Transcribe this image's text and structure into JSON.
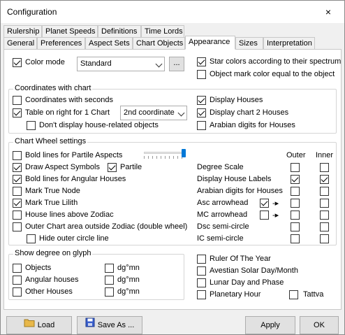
{
  "window": {
    "title": "Configuration",
    "close": "×"
  },
  "tabs_row1": [
    "Rulership",
    "Planet Speeds",
    "Definitions",
    "Time Lords"
  ],
  "tabs_row2": [
    "General",
    "Preferences",
    "Aspect Sets",
    "Chart Objects",
    "Appearance",
    "Sizes",
    "Interpretation"
  ],
  "top": {
    "color_mode": "Color mode",
    "color_mode_value": "Standard",
    "ellipsis": "...",
    "star_colors": "Star colors according to their spectrum",
    "object_mark": "Object mark color equal to the object"
  },
  "coords": {
    "legend": "Coordinates with chart",
    "with_seconds": "Coordinates with seconds",
    "table_right": "Table on right for 1 Chart",
    "coord_value": "2nd coordinate",
    "no_house": "Don't display house-related objects",
    "display_houses": "Display Houses",
    "display_chart2": "Display chart 2 Houses",
    "arabian_houses": "Arabian digits for Houses"
  },
  "wheel": {
    "legend": "Chart Wheel settings",
    "bold_partile": "Bold lines for Partile Aspects",
    "draw_aspect": "Draw Aspect Symbols",
    "partile": "Partile",
    "bold_angular": "Bold lines for Angular Houses",
    "mark_node": "Mark True Node",
    "mark_lilith": "Mark True Lilith",
    "house_above": "House lines above Zodiac",
    "outer_area": "Outer Chart area outside Zodiac (double wheel)",
    "hide_outer": "Hide outer circle line",
    "outer": "Outer",
    "inner": "Inner",
    "right_rows": [
      "Degree Scale",
      "Display House Labels",
      "Arabian digits for Houses",
      "Asc arrowhead",
      "MC arrowhead",
      "Dsc semi-circle",
      "IC semi-circle"
    ],
    "arrow": "-▸"
  },
  "glyph": {
    "legend": "Show degree on glyph",
    "objects": "Objects",
    "angular": "Angular houses",
    "other": "Other Houses",
    "dgmn": "dg°mn"
  },
  "right_bottom": {
    "ruler_year": "Ruler Of The Year",
    "avestian": "Avestian Solar Day/Month",
    "lunar": "Lunar Day and Phase",
    "planetary": "Planetary Hour",
    "tattva": "Tattva"
  },
  "buttons": {
    "load": "Load",
    "save_as": "Save As ...",
    "apply": "Apply",
    "ok": "OK"
  }
}
